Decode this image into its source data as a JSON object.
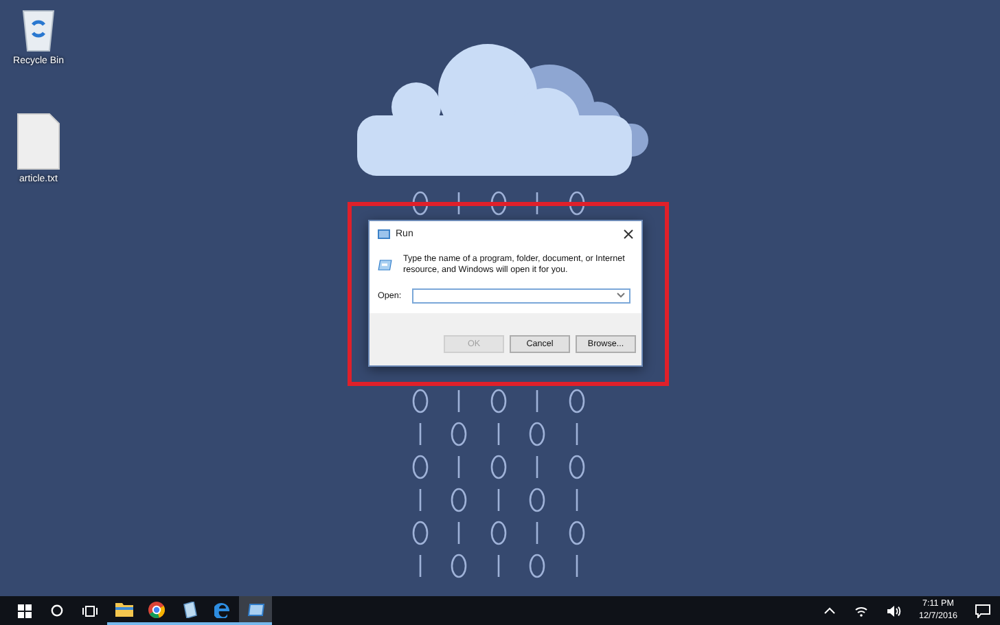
{
  "desktop_icons": [
    {
      "label": "Recycle Bin",
      "kind": "recycle-bin"
    },
    {
      "label": "article.txt",
      "kind": "text-file"
    }
  ],
  "dialog": {
    "title": "Run",
    "message": "Type the name of a program, folder, document, or Internet resource, and Windows will open it for you.",
    "open_label": "Open:",
    "buttons": [
      {
        "label": "OK",
        "disabled": true
      },
      {
        "label": "Cancel",
        "disabled": false
      },
      {
        "label": "Browse...",
        "disabled": false
      }
    ]
  },
  "taskbar": {
    "apps": [
      {
        "kind": "folder",
        "active": false
      },
      {
        "kind": "browser-ball",
        "active": false
      },
      {
        "kind": "notepad",
        "active": false
      },
      {
        "kind": "edge",
        "active": false
      },
      {
        "kind": "run",
        "active": true
      }
    ],
    "time": "7:11 PM",
    "date": "12/7/2016"
  }
}
